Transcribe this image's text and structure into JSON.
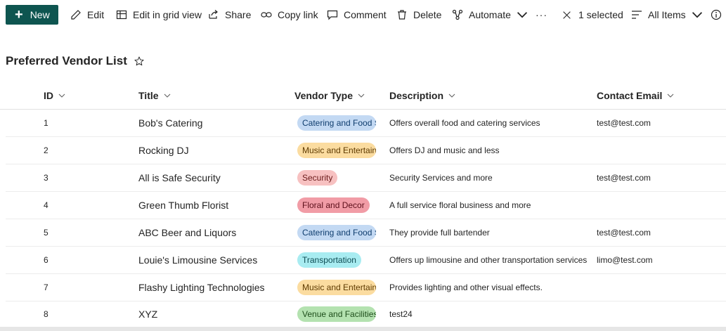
{
  "toolbar": {
    "new_label": "New",
    "edit_label": "Edit",
    "grid_label": "Edit in grid view",
    "share_label": "Share",
    "copy_label": "Copy link",
    "comment_label": "Comment",
    "delete_label": "Delete",
    "automate_label": "Automate",
    "more_label": "···",
    "selected_label": "1 selected",
    "view_label": "All Items"
  },
  "list": {
    "title": "Preferred Vendor List",
    "columns": {
      "id": "ID",
      "title": "Title",
      "vendor_type": "Vendor Type",
      "description": "Description",
      "contact_email": "Contact Email"
    },
    "rows": [
      {
        "id": "1",
        "title": "Bob's Catering",
        "vendor_type": "Catering and Food Se",
        "type_bg": "#c3d9f3",
        "type_fg": "#0f3d6e",
        "description": "Offers overall food and catering services",
        "email": "test@test.com"
      },
      {
        "id": "2",
        "title": "Rocking DJ",
        "vendor_type": "Music and Entertainm",
        "type_bg": "#fbdca0",
        "type_fg": "#5e3a00",
        "description": "Offers DJ and music and less",
        "email": ""
      },
      {
        "id": "3",
        "title": "All is Safe Security",
        "vendor_type": "Security",
        "type_bg": "#f7c1c1",
        "type_fg": "#6b1a1a",
        "description": "Security Services and more",
        "email": "test@test.com"
      },
      {
        "id": "4",
        "title": "Green Thumb Florist",
        "vendor_type": "Floral and Decor",
        "type_bg": "#f19ca6",
        "type_fg": "#5c0f1a",
        "description": "A full service floral business and more",
        "email": ""
      },
      {
        "id": "5",
        "title": "ABC Beer and Liquors",
        "vendor_type": "Catering and Food Se",
        "type_bg": "#c3d9f3",
        "type_fg": "#0f3d6e",
        "description": "They provide full bartender",
        "email": "test@test.com"
      },
      {
        "id": "6",
        "title": "Louie's Limousine Services",
        "vendor_type": "Transportation",
        "type_bg": "#a8ecf1",
        "type_fg": "#0d4b52",
        "description": "Offers up limousine and other transportation services",
        "email": "limo@test.com"
      },
      {
        "id": "7",
        "title": "Flashy Lighting Technologies",
        "vendor_type": "Music and Entertainm",
        "type_bg": "#fbdca0",
        "type_fg": "#5e3a00",
        "description": "Provides lighting and other visual effects.",
        "email": ""
      },
      {
        "id": "8",
        "title": "XYZ",
        "vendor_type": "Venue and Facilities",
        "type_bg": "#b4e2b0",
        "type_fg": "#1d4d1a",
        "description": "test24",
        "email": ""
      }
    ]
  },
  "colors": {
    "brand": "#0e5550"
  },
  "icons": [
    "plus-icon",
    "edit-icon",
    "grid-icon",
    "share-icon",
    "link-icon",
    "comment-icon",
    "delete-icon",
    "automate-icon",
    "close-icon",
    "view-icon",
    "info-icon",
    "star-icon",
    "chevron-down-icon"
  ]
}
